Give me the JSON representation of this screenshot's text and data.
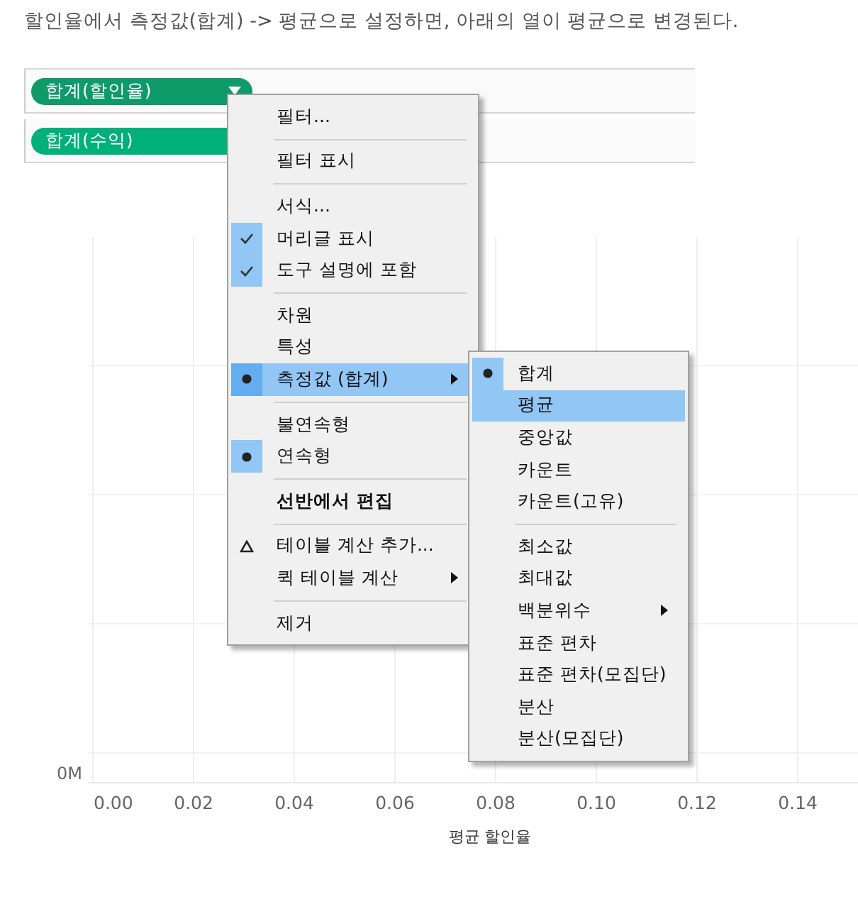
{
  "caption": "할인율에서 측정값(합계) -> 평균으로 설정하면, 아래의 열이 평균으로 변경된다.",
  "shelf": {
    "pills": [
      {
        "label": "합계(할인율)",
        "color": "#0e9a69",
        "has_dropdown": true
      },
      {
        "label": "합계(수익)",
        "color": "#00b07b",
        "has_dropdown": false
      }
    ]
  },
  "chart": {
    "y_tick": "0M",
    "x_ticks": [
      "0.00",
      "0.02",
      "0.04",
      "0.06",
      "0.08",
      "0.10",
      "0.12",
      "0.14"
    ],
    "x_title": "평균 할인율"
  },
  "context_menu": {
    "items": [
      {
        "kind": "item",
        "label": "필터...",
        "checked": false,
        "radio": false,
        "highlighted": false,
        "submenu": false
      },
      {
        "kind": "separator"
      },
      {
        "kind": "item",
        "label": "필터 표시",
        "checked": false,
        "radio": false,
        "highlighted": false,
        "submenu": false
      },
      {
        "kind": "separator"
      },
      {
        "kind": "item",
        "label": "서식...",
        "checked": false,
        "radio": false,
        "highlighted": false,
        "submenu": false
      },
      {
        "kind": "item",
        "label": "머리글 표시",
        "checked": true,
        "radio": false,
        "highlighted": false,
        "submenu": false
      },
      {
        "kind": "item",
        "label": "도구 설명에 포함",
        "checked": true,
        "radio": false,
        "highlighted": false,
        "submenu": false
      },
      {
        "kind": "separator"
      },
      {
        "kind": "item",
        "label": "차원",
        "checked": false,
        "radio": false,
        "highlighted": false,
        "submenu": false
      },
      {
        "kind": "item",
        "label": "특성",
        "checked": false,
        "radio": false,
        "highlighted": false,
        "submenu": false
      },
      {
        "kind": "item",
        "label": "측정값 (합계)",
        "checked": false,
        "radio": true,
        "highlighted": true,
        "submenu": true
      },
      {
        "kind": "separator"
      },
      {
        "kind": "item",
        "label": "불연속형",
        "checked": false,
        "radio": false,
        "highlighted": false,
        "submenu": false
      },
      {
        "kind": "item",
        "label": "연속형",
        "checked": false,
        "radio": true,
        "highlighted": false,
        "submenu": false
      },
      {
        "kind": "separator"
      },
      {
        "kind": "bold_item",
        "label": "선반에서 편집",
        "checked": false,
        "radio": false,
        "highlighted": false,
        "submenu": false
      },
      {
        "kind": "separator"
      },
      {
        "kind": "delta_item",
        "label": "테이블 계산 추가...",
        "checked": false,
        "radio": false,
        "highlighted": false,
        "submenu": false
      },
      {
        "kind": "item",
        "label": "퀵 테이블 계산",
        "checked": false,
        "radio": false,
        "highlighted": false,
        "submenu": true
      },
      {
        "kind": "separator"
      },
      {
        "kind": "item",
        "label": "제거",
        "checked": false,
        "radio": false,
        "highlighted": false,
        "submenu": false
      }
    ]
  },
  "submenu": {
    "items": [
      {
        "kind": "item",
        "label": "합계",
        "checked": false,
        "radio": true,
        "highlighted": false,
        "submenu": false
      },
      {
        "kind": "item",
        "label": "평균",
        "checked": false,
        "radio": false,
        "highlighted": true,
        "submenu": false
      },
      {
        "kind": "item",
        "label": "중앙값",
        "checked": false,
        "radio": false,
        "highlighted": false,
        "submenu": false
      },
      {
        "kind": "item",
        "label": "카운트",
        "checked": false,
        "radio": false,
        "highlighted": false,
        "submenu": false
      },
      {
        "kind": "item",
        "label": "카운트(고유)",
        "checked": false,
        "radio": false,
        "highlighted": false,
        "submenu": false
      },
      {
        "kind": "separator"
      },
      {
        "kind": "item",
        "label": "최소값",
        "checked": false,
        "radio": false,
        "highlighted": false,
        "submenu": false
      },
      {
        "kind": "item",
        "label": "최대값",
        "checked": false,
        "radio": false,
        "highlighted": false,
        "submenu": false
      },
      {
        "kind": "item",
        "label": "백분위수",
        "checked": false,
        "radio": false,
        "highlighted": false,
        "submenu": true
      },
      {
        "kind": "item",
        "label": "표준 편차",
        "checked": false,
        "radio": false,
        "highlighted": false,
        "submenu": false
      },
      {
        "kind": "item",
        "label": "표준 편차(모집단)",
        "checked": false,
        "radio": false,
        "highlighted": false,
        "submenu": false
      },
      {
        "kind": "item",
        "label": "분산",
        "checked": false,
        "radio": false,
        "highlighted": false,
        "submenu": false
      },
      {
        "kind": "item",
        "label": "분산(모집단)",
        "checked": false,
        "radio": false,
        "highlighted": false,
        "submenu": false
      }
    ]
  }
}
